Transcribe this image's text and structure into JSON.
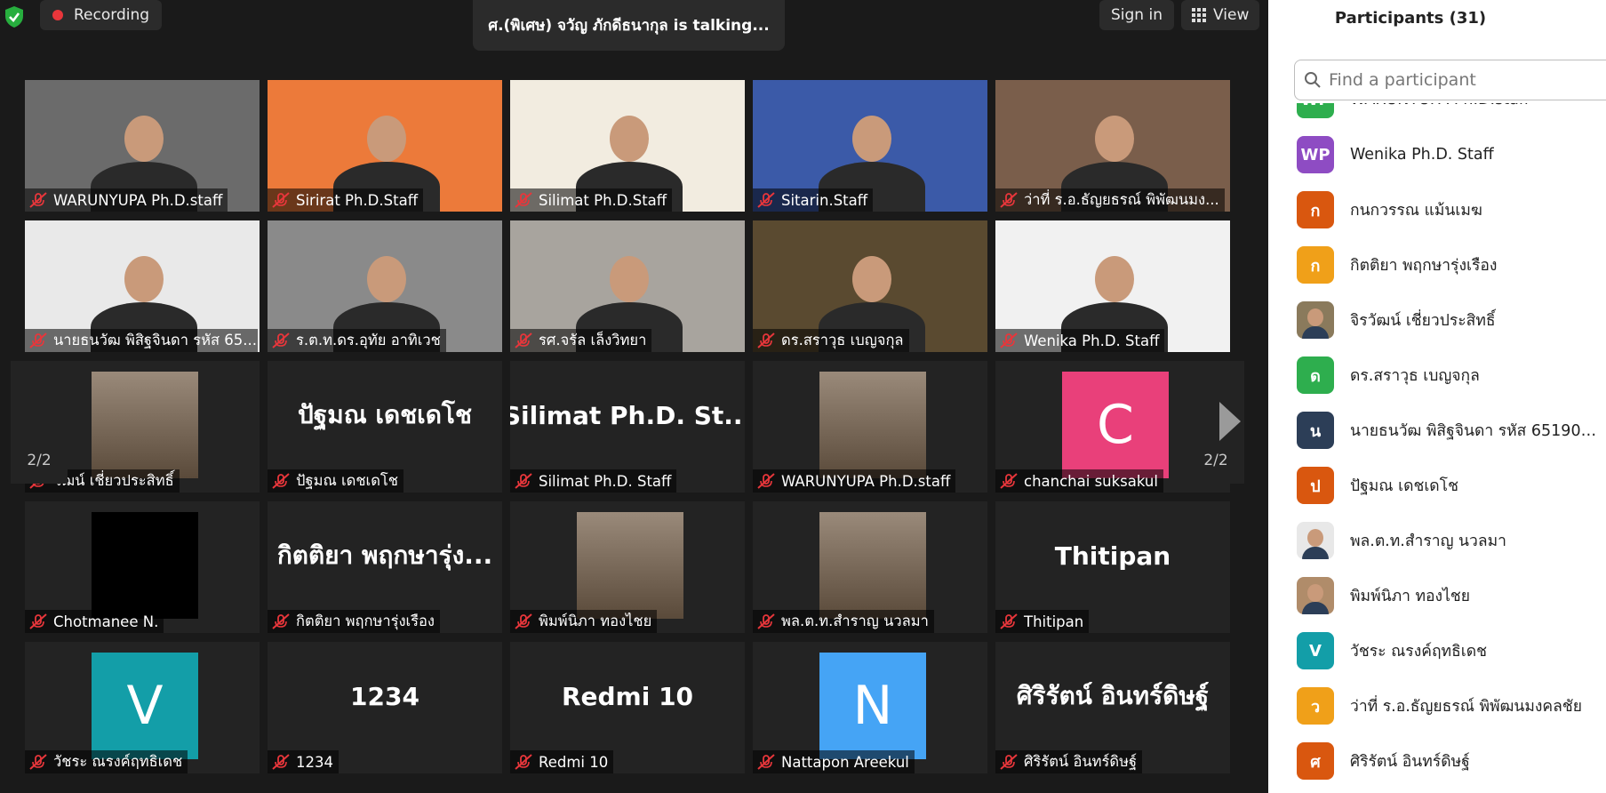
{
  "toolbar": {
    "recording_label": "Recording",
    "talking_text": "ศ.(พิเศษ) จวัญ ภักดีธนากุล is talking...",
    "signin_label": "Sign in",
    "view_label": "View"
  },
  "colors": {
    "recording_dot": "#e8363b",
    "shield": "#27ae3e",
    "nav_arrow_left": "#2d8cff",
    "nav_arrow_right": "#9a9a9a"
  },
  "grid": {
    "page_left": "2/2",
    "page_right": "2/2",
    "tiles": [
      {
        "name": "WARUNYUPA Ph.D.staff",
        "kind": "video"
      },
      {
        "name": "Sirirat Ph.D.Staff",
        "kind": "video"
      },
      {
        "name": "Silimat Ph.D.Staff",
        "kind": "video"
      },
      {
        "name": "Sitarin.Staff",
        "kind": "video"
      },
      {
        "name": "ว่าที่ ร.อ.ธัญยธรณ์ พิพัฒนมง...",
        "kind": "video"
      },
      {
        "name": "นายธนวัฒ พิสิฐจินดา รหัส 65...",
        "kind": "video"
      },
      {
        "name": "ร.ต.ท.ดร.อุทัย อาทิเวช",
        "kind": "video"
      },
      {
        "name": "รศ.จรัล เล็งวิทยา",
        "kind": "video"
      },
      {
        "name": "ดร.สราวุธ เบญจกุล",
        "kind": "video"
      },
      {
        "name": "Wenika Ph.D. Staff",
        "kind": "video"
      },
      {
        "name": "วัฒน์ เชี่ยวประสิทธิ์",
        "kind": "photo"
      },
      {
        "name": "ปัฐมณ เดชเดโช",
        "kind": "text",
        "big": "ปัฐมณ เดชเดโช"
      },
      {
        "name": "Silimat Ph.D. Staff",
        "kind": "text",
        "big": "Silimat Ph.D. St..."
      },
      {
        "name": "WARUNYUPA Ph.D.staff",
        "kind": "photo"
      },
      {
        "name": "chanchai suksakul",
        "kind": "letter",
        "letter": "C",
        "color": "#e9407a"
      },
      {
        "name": "Chotmanee N.",
        "kind": "black"
      },
      {
        "name": "กิตติยา พฤกษารุ่งเรือง",
        "kind": "text",
        "big": "กิตติยา พฤกษารุ่ง..."
      },
      {
        "name": "พิมพ์นิภา ทองไชย",
        "kind": "photo"
      },
      {
        "name": "พล.ต.ท.สำราญ นวลมา",
        "kind": "photo"
      },
      {
        "name": "Thitipan",
        "kind": "text",
        "big": "Thitipan"
      },
      {
        "name": "วัชระ ณรงค์ฤทธิเดช",
        "kind": "letter",
        "letter": "V",
        "color": "#139ea8"
      },
      {
        "name": "1234",
        "kind": "text",
        "big": "1234"
      },
      {
        "name": "Redmi 10",
        "kind": "text",
        "big": "Redmi 10"
      },
      {
        "name": "Nattapon Areekul",
        "kind": "letter",
        "letter": "N",
        "color": "#45a4f5"
      },
      {
        "name": "ศิริรัตน์ อินทร์ดิษฐ์",
        "kind": "text",
        "big": "ศิริรัตน์ อินทร์ดิษฐ์"
      }
    ]
  },
  "participants": {
    "title": "Participants (31)",
    "search_placeholder": "Find a participant",
    "items": [
      {
        "initials": "WP",
        "name": "WARUNYUPA Ph.D.staff",
        "color": "#2eae4e"
      },
      {
        "initials": "WP",
        "name": "Wenika Ph.D. Staff",
        "color": "#8e4cc3"
      },
      {
        "initials": "ก",
        "name": "กนกวรรณ แม้นเมฆ",
        "color": "#d9570f"
      },
      {
        "initials": "ก",
        "name": "กิตติยา พฤกษารุ่งเรือง",
        "color": "#f0a019"
      },
      {
        "initials": "",
        "name": "จิรวัฒน์ เชี่ยวประสิทธิ์",
        "color": "#8a7a5c"
      },
      {
        "initials": "ด",
        "name": "ดร.สราวุธ เบญจกุล",
        "color": "#2eae4e"
      },
      {
        "initials": "น",
        "name": "นายธนวัฒ พิสิฐจินดา รหัส 651901...",
        "color": "#2c3e57"
      },
      {
        "initials": "ป",
        "name": "ปัฐมณ เดชเดโช",
        "color": "#d9570f"
      },
      {
        "initials": "",
        "name": "พล.ต.ท.สำราญ นวลมา",
        "color": "#e8e8e8"
      },
      {
        "initials": "",
        "name": "พิมพ์นิภา ทองไชย",
        "color": "#b08c6a"
      },
      {
        "initials": "V",
        "name": "วัชระ ณรงค์ฤทธิเดช",
        "color": "#139ea8"
      },
      {
        "initials": "ว",
        "name": "ว่าที่ ร.อ.ธัญยธรณ์ พิพัฒนมงคลชัย",
        "color": "#f0a019"
      },
      {
        "initials": "ศ",
        "name": "ศิริรัตน์ อินทร์ดิษฐ์",
        "color": "#d9570f"
      }
    ]
  }
}
